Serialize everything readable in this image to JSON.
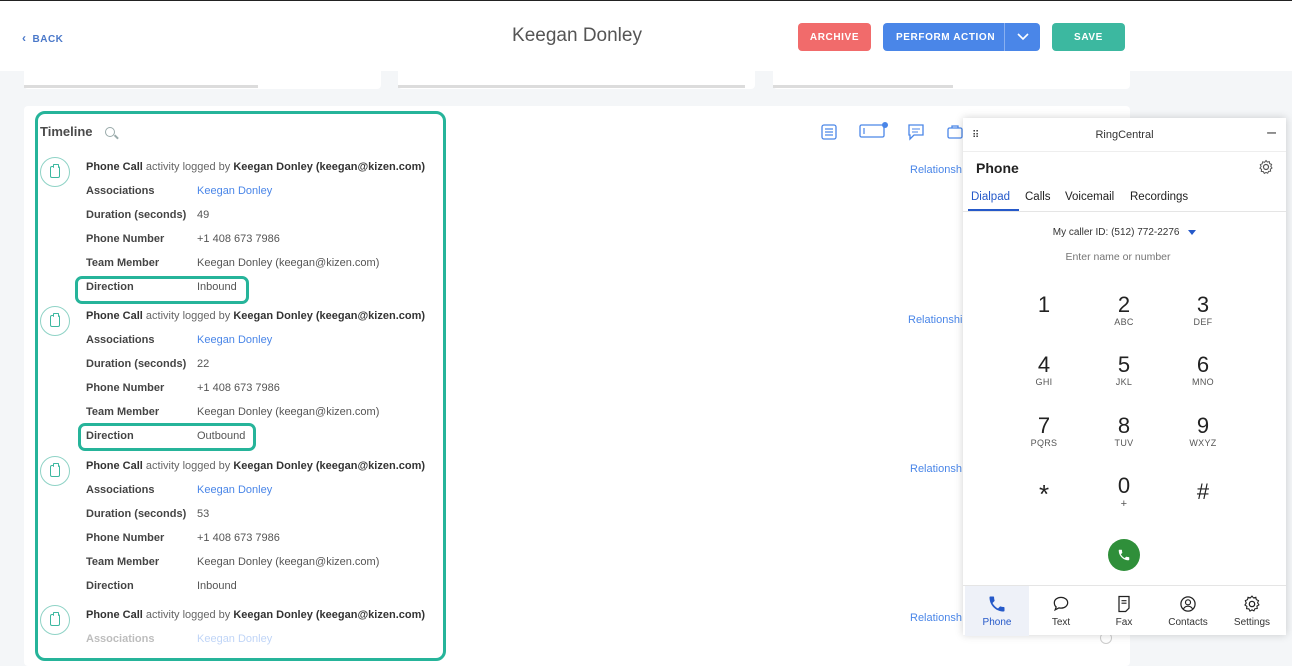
{
  "header": {
    "back_label": "BACK",
    "title": "Keegan Donley",
    "archive_label": "ARCHIVE",
    "action_label": "PERFORM ACTION",
    "save_label": "SAVE"
  },
  "colors": {
    "archive": "#f16b6b",
    "action": "#4a86e8",
    "save": "#3cb8a0",
    "highlight": "#26b49a",
    "ringcentral_accent": "#2559c9",
    "call_button": "#2f8f3a"
  },
  "timeline": {
    "title": "Timeline",
    "toolbar_icons": [
      "list-icon",
      "ticket-icon",
      "chat-icon",
      "briefcase-icon"
    ],
    "entries": [
      {
        "type": "Phone Call",
        "middle": "activity logged by",
        "author": "Keegan Donley (keegan@kizen.com)",
        "rows": [
          {
            "label": "Associations",
            "value": "Keegan Donley"
          },
          {
            "label": "Duration (seconds)",
            "value": "49"
          },
          {
            "label": "Phone Number",
            "value": "+1 408 673 7986"
          },
          {
            "label": "Team Member",
            "value": "Keegan Donley (keegan@kizen.com)"
          },
          {
            "label": "Direction",
            "value": "Inbound"
          }
        ],
        "relationship": "Relationsh"
      },
      {
        "type": "Phone Call",
        "middle": "activity logged by",
        "author": "Keegan Donley (keegan@kizen.com)",
        "rows": [
          {
            "label": "Associations",
            "value": "Keegan Donley"
          },
          {
            "label": "Duration (seconds)",
            "value": "22"
          },
          {
            "label": "Phone Number",
            "value": "+1 408 673 7986"
          },
          {
            "label": "Team Member",
            "value": "Keegan Donley (keegan@kizen.com)"
          },
          {
            "label": "Direction",
            "value": "Outbound"
          }
        ],
        "relationship": "Relationshi"
      },
      {
        "type": "Phone Call",
        "middle": "activity logged by",
        "author": "Keegan Donley (keegan@kizen.com)",
        "rows": [
          {
            "label": "Associations",
            "value": "Keegan Donley"
          },
          {
            "label": "Duration (seconds)",
            "value": "53"
          },
          {
            "label": "Phone Number",
            "value": "+1 408 673 7986"
          },
          {
            "label": "Team Member",
            "value": "Keegan Donley (keegan@kizen.com)"
          },
          {
            "label": "Direction",
            "value": "Inbound"
          }
        ],
        "relationship": "Relationsh"
      },
      {
        "type": "Phone Call",
        "middle": "activity logged by",
        "author": "Keegan Donley (keegan@kizen.com)",
        "rows": [
          {
            "label": "Associations",
            "value": "Keegan Donley"
          }
        ],
        "relationship": "Relationsh"
      }
    ]
  },
  "ringcentral": {
    "app_name": "RingCentral",
    "section_title": "Phone",
    "tabs": [
      "Dialpad",
      "Calls",
      "Voicemail",
      "Recordings"
    ],
    "active_tab": "Dialpad",
    "caller_id_label": "My caller ID:",
    "caller_id_value": "(512) 772-2276",
    "input_placeholder": "Enter name or number",
    "keys": [
      {
        "digit": "1",
        "letters": ""
      },
      {
        "digit": "2",
        "letters": "ABC"
      },
      {
        "digit": "3",
        "letters": "DEF"
      },
      {
        "digit": "4",
        "letters": "GHI"
      },
      {
        "digit": "5",
        "letters": "JKL"
      },
      {
        "digit": "6",
        "letters": "MNO"
      },
      {
        "digit": "7",
        "letters": "PQRS"
      },
      {
        "digit": "8",
        "letters": "TUV"
      },
      {
        "digit": "9",
        "letters": "WXYZ"
      },
      {
        "digit": "*",
        "letters": ""
      },
      {
        "digit": "0",
        "letters": "+"
      },
      {
        "digit": "#",
        "letters": ""
      }
    ],
    "nav": [
      {
        "label": "Phone",
        "icon": "phone-icon"
      },
      {
        "label": "Text",
        "icon": "chat-bubble-icon"
      },
      {
        "label": "Fax",
        "icon": "fax-icon"
      },
      {
        "label": "Contacts",
        "icon": "contacts-icon"
      },
      {
        "label": "Settings",
        "icon": "settings-icon"
      }
    ],
    "active_nav": "Phone"
  }
}
